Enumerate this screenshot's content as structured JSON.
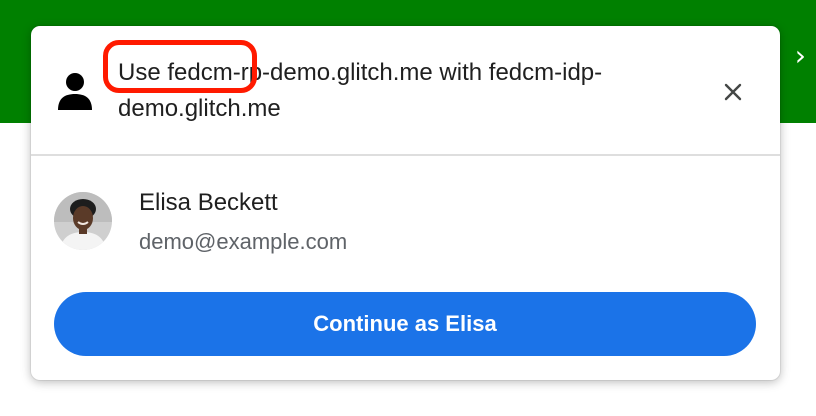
{
  "page": {
    "nav_arrows": "‹ ›"
  },
  "dialog": {
    "title": "Use fedcm-rp-demo.glitch.me with fedcm-idp-demo.glitch.me",
    "header_icon": "person-icon",
    "close_icon": "close-icon",
    "account": {
      "name": "Elisa Beckett",
      "email": "demo@example.com",
      "avatar": "avatar-photo"
    },
    "continue_label": "Continue as Elisa"
  },
  "colors": {
    "page_header_green": "#008000",
    "highlight_red": "#ff1a00",
    "button_blue": "#1b73e8",
    "text_primary": "#1f1f1f",
    "text_secondary": "#5f6368"
  }
}
